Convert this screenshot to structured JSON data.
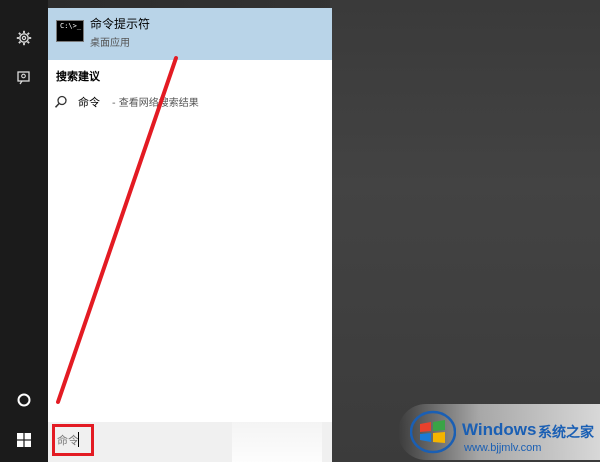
{
  "start_panel": {
    "best_match": {
      "title": "命令提示符",
      "subtitle": "桌面应用",
      "tile_prompt": "C:\\>_"
    },
    "suggestions_heading": "搜索建议",
    "suggestion": {
      "term": "命令",
      "rest": " - 查看网络搜索结果"
    }
  },
  "search": {
    "value": "命令"
  },
  "watermark": {
    "brand": "Windows",
    "brand_cn": "系统之家",
    "url": "www.bjjmlv.com"
  },
  "colors": {
    "highlight": "#b9d4e8",
    "annotation": "#e31b23",
    "rail": "#1b1b1b",
    "brand_blue": "#1a5fb4"
  }
}
